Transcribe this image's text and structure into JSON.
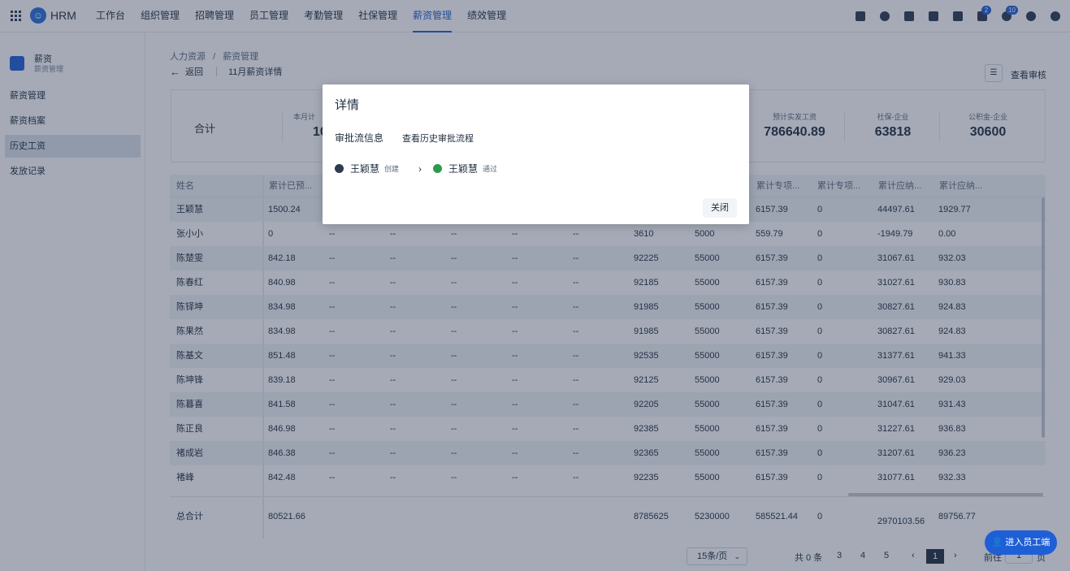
{
  "app": {
    "brand": "HRM"
  },
  "nav": [
    "工作台",
    "组织管理",
    "招聘管理",
    "员工管理",
    "考勤管理",
    "社保管理",
    "薪资管理",
    "绩效管理"
  ],
  "top_badges": {
    "flag": "2",
    "bell": "10"
  },
  "sidebar": {
    "title": "薪资",
    "subtitle": "薪资管理",
    "items": [
      "薪资管理",
      "薪资档案",
      "历史工资",
      "发放记录"
    ]
  },
  "breadcrumb": {
    "root": "人力资源",
    "sep": "/",
    "current": "薪资管理"
  },
  "page": {
    "back_label": "返回",
    "title": "11月薪资详情",
    "review_link": "查看审核"
  },
  "summary": {
    "label": "合计",
    "stats": [
      {
        "label": "本月计",
        "value": "10"
      },
      {
        "label": "预计实发工资",
        "value": "786640.89"
      },
      {
        "label": "社保-企业",
        "value": "63818"
      },
      {
        "label": "公积金-企业",
        "value": "30600"
      }
    ]
  },
  "table": {
    "headers": [
      "姓名",
      "累计已预...",
      "累计专项...",
      "累计专项...",
      "累计应纳...",
      "累计应纳..."
    ],
    "rows": [
      [
        "王颖慧",
        "1500.24",
        "",
        "",
        "",
        "",
        "",
        "",
        "",
        "6157.39",
        "0",
        "44497.61",
        "1929.77"
      ],
      [
        "张小小",
        "0",
        "--",
        "--",
        "--",
        "--",
        "--",
        "3610",
        "5000",
        "559.79",
        "0",
        "-1949.79",
        "0.00"
      ],
      [
        "陈楚雯",
        "842.18",
        "--",
        "--",
        "--",
        "--",
        "--",
        "92225",
        "55000",
        "6157.39",
        "0",
        "31067.61",
        "932.03"
      ],
      [
        "陈春红",
        "840.98",
        "--",
        "--",
        "--",
        "--",
        "--",
        "92185",
        "55000",
        "6157.39",
        "0",
        "31027.61",
        "930.83"
      ],
      [
        "陈铎坤",
        "834.98",
        "--",
        "--",
        "--",
        "--",
        "--",
        "91985",
        "55000",
        "6157.39",
        "0",
        "30827.61",
        "924.83"
      ],
      [
        "陈果然",
        "834.98",
        "--",
        "--",
        "--",
        "--",
        "--",
        "91985",
        "55000",
        "6157.39",
        "0",
        "30827.61",
        "924.83"
      ],
      [
        "陈基文",
        "851.48",
        "--",
        "--",
        "--",
        "--",
        "--",
        "92535",
        "55000",
        "6157.39",
        "0",
        "31377.61",
        "941.33"
      ],
      [
        "陈坤锋",
        "839.18",
        "--",
        "--",
        "--",
        "--",
        "--",
        "92125",
        "55000",
        "6157.39",
        "0",
        "30967.61",
        "929.03"
      ],
      [
        "陈暮喜",
        "841.58",
        "--",
        "--",
        "--",
        "--",
        "--",
        "92205",
        "55000",
        "6157.39",
        "0",
        "31047.61",
        "931.43"
      ],
      [
        "陈正良",
        "846.98",
        "--",
        "--",
        "--",
        "--",
        "--",
        "92385",
        "55000",
        "6157.39",
        "0",
        "31227.61",
        "936.83"
      ],
      [
        "褚成岩",
        "846.38",
        "--",
        "--",
        "--",
        "--",
        "--",
        "92365",
        "55000",
        "6157.39",
        "0",
        "31207.61",
        "936.23"
      ],
      [
        "褚峰",
        "842.48",
        "--",
        "--",
        "--",
        "--",
        "--",
        "92235",
        "55000",
        "6157.39",
        "0",
        "31077.61",
        "932.33"
      ]
    ],
    "total": [
      "总合计",
      "80521.66",
      "",
      "",
      "",
      "",
      "",
      "8785625",
      "5230000",
      "585521.44",
      "0",
      "2970103.56",
      "89756.77"
    ]
  },
  "pager": {
    "page_size": "15条/页",
    "total": "共 0 条",
    "pages": [
      "3",
      "4",
      "5"
    ],
    "prev": "‹",
    "next": "›",
    "current": "1",
    "goto_prefix": "前往",
    "goto_value": "1",
    "goto_suffix": "页"
  },
  "float_button": "进入员工端",
  "modal": {
    "title": "详情",
    "section_label": "审批流信息",
    "history_link": "查看历史审批流程",
    "flow": [
      {
        "name": "王颖慧",
        "tag": "创建"
      },
      {
        "name": "王颖慧",
        "tag": "通过"
      }
    ],
    "close_label": "关闭"
  }
}
